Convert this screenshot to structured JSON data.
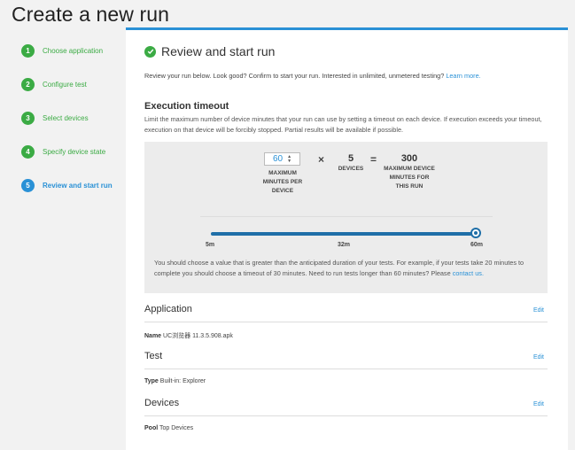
{
  "page": {
    "title": "Create a new run"
  },
  "steps": [
    {
      "num": "1",
      "label": "Choose application",
      "state": "done"
    },
    {
      "num": "2",
      "label": "Configure test",
      "state": "done"
    },
    {
      "num": "3",
      "label": "Select devices",
      "state": "done"
    },
    {
      "num": "4",
      "label": "Specify device state",
      "state": "done"
    },
    {
      "num": "5",
      "label": "Review and start run",
      "state": "active"
    }
  ],
  "panel": {
    "title": "Review and start run",
    "intro": "Review your run below. Look good? Confirm to start your run. Interested in unlimited, unmetered testing?",
    "learn_more": "Learn more."
  },
  "timeout": {
    "title": "Execution timeout",
    "description": "Limit the maximum number of device minutes that your run can use by setting a timeout on each device. If execution exceeds your timeout, execution on that device will be forcibly stopped. Partial results will be available if possible.",
    "minutes_value": "60",
    "minutes_label": "MAXIMUM MINUTES PER DEVICE",
    "times_symbol": "×",
    "devices_value": "5",
    "devices_label": "DEVICES",
    "equals_symbol": "=",
    "total_value": "300",
    "total_label": "MAXIMUM DEVICE MINUTES FOR THIS RUN",
    "slider": {
      "min_label": "5m",
      "mid_label": "32m",
      "max_label": "60m",
      "value_minutes": 60,
      "min": 5,
      "max": 60
    },
    "note": "You should choose a value that is greater than the anticipated duration of your tests. For example, if your tests take 20 minutes to complete you should choose a timeout of 30 minutes. Need to run tests longer than 60 minutes? Please",
    "contact_link": "contact us."
  },
  "sections": {
    "application": {
      "title": "Application",
      "edit": "Edit",
      "key": "Name",
      "value": "UC浏览器 11.3.5.908.apk"
    },
    "test": {
      "title": "Test",
      "edit": "Edit",
      "key": "Type",
      "value": "Built-in: Explorer"
    },
    "devices": {
      "title": "Devices",
      "edit": "Edit",
      "key": "Pool",
      "value": "Top Devices"
    }
  }
}
